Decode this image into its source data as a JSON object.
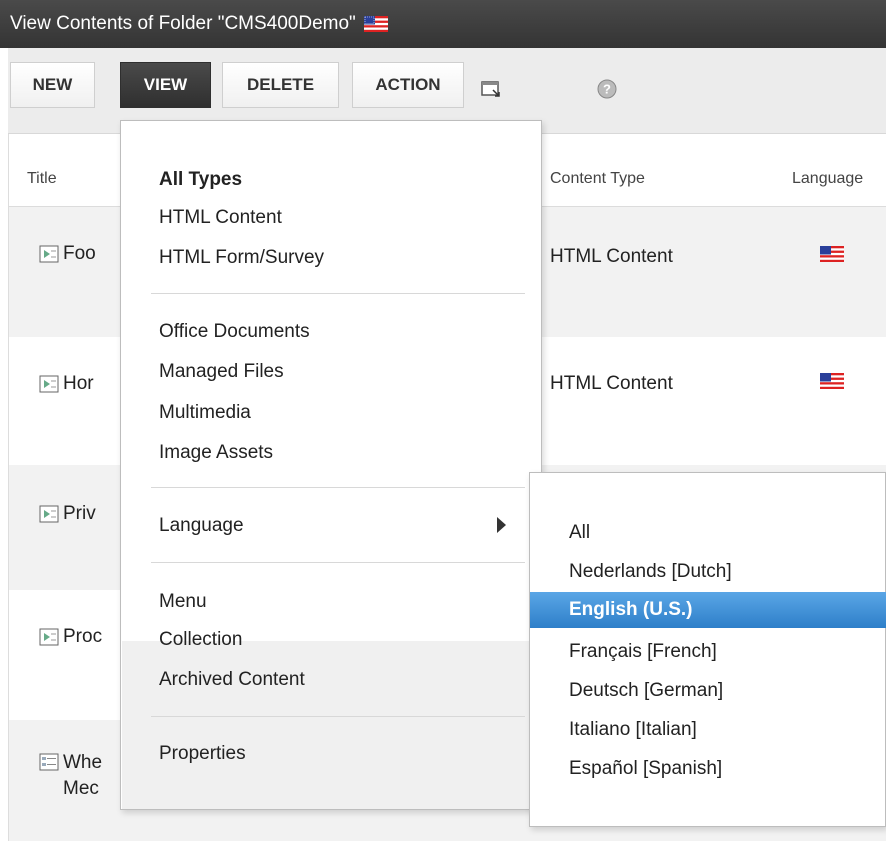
{
  "window": {
    "title": "View Contents of Folder \"CMS400Demo\"",
    "flag_icon": "us-flag-icon"
  },
  "toolbar": {
    "buttons": [
      {
        "label": "NEW"
      },
      {
        "label": "VIEW",
        "active": true
      },
      {
        "label": "DELETE"
      },
      {
        "label": "ACTION"
      }
    ],
    "icons": [
      "move-window-icon",
      "help-icon"
    ]
  },
  "table": {
    "columns": {
      "title": "Title",
      "content_type": "Content Type",
      "language": "Language"
    },
    "rows": [
      {
        "title": "Foo",
        "content_type": "HTML Content",
        "flag": true,
        "icon": "html-content-icon"
      },
      {
        "title": "Hor",
        "content_type": "HTML Content",
        "flag": true,
        "icon": "html-content-icon"
      },
      {
        "title": "Priv",
        "content_type": "",
        "flag": false,
        "icon": "html-content-icon"
      },
      {
        "title": "Proc",
        "content_type": "",
        "flag": false,
        "icon": "html-content-icon"
      },
      {
        "title": "Whe",
        "title_line2": "Mec",
        "content_type": "",
        "flag": false,
        "icon": "form-icon"
      }
    ]
  },
  "view_menu": {
    "groups": [
      [
        "All Types",
        "HTML Content",
        "HTML Form/Survey"
      ],
      [
        "Office Documents",
        "Managed Files",
        "Multimedia",
        "Image Assets"
      ],
      [
        "Language"
      ],
      [
        "Menu",
        "Collection",
        "Archived Content"
      ],
      [
        "Properties"
      ]
    ]
  },
  "language_submenu": {
    "items": [
      "All",
      "Nederlands [Dutch]",
      "English (U.S.)",
      "Français [French]",
      "Deutsch [German]",
      "Italiano [Italian]",
      "Español [Spanish]"
    ],
    "selected": "English (U.S.)"
  },
  "colors": {
    "titlebar": "#3d3d3d",
    "selected_item": "#3b8ad6"
  }
}
